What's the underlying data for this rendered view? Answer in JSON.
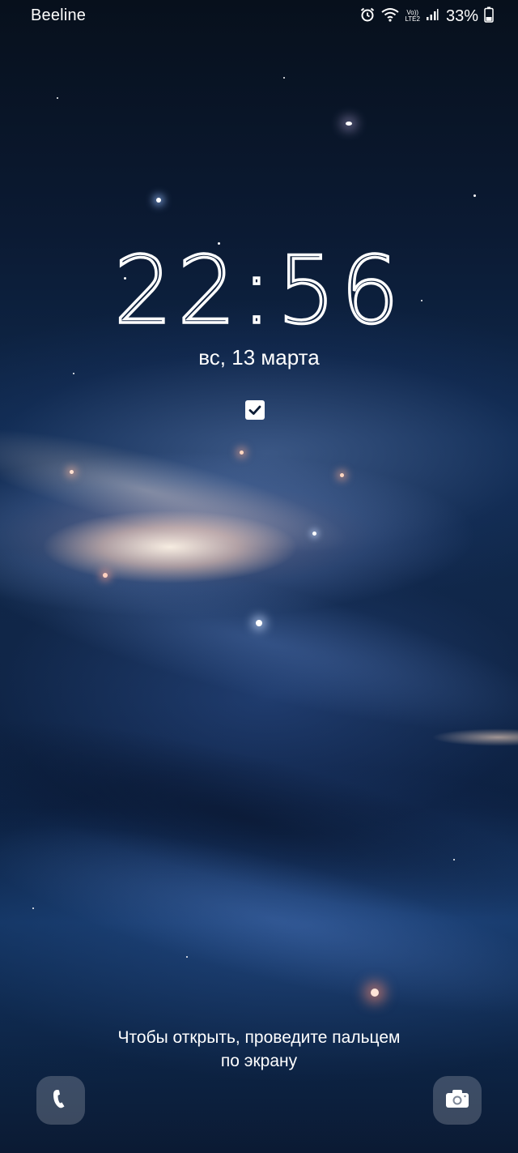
{
  "status_bar": {
    "carrier": "Beeline",
    "icons": [
      "alarm-icon",
      "wifi-icon",
      "volte-lte2-icon",
      "signal-icon",
      "battery-icon"
    ],
    "volte_label": "Vo))",
    "lte_label": "LTE2",
    "battery_percent": "33%",
    "battery_level": 0.33
  },
  "lockscreen": {
    "time_hours": "22",
    "time_separator": ":",
    "time_minutes": "56",
    "date": "вс, 13 марта",
    "notification_icons": [
      "checkbox-task-icon"
    ],
    "unlock_hint_line1": "Чтобы открыть, проведите пальцем",
    "unlock_hint_line2": "по экрану"
  },
  "shortcuts": {
    "left": "phone-icon",
    "right": "camera-icon"
  },
  "colors": {
    "text": "#ffffff",
    "shortcut_bg": "#e6e8ee"
  }
}
